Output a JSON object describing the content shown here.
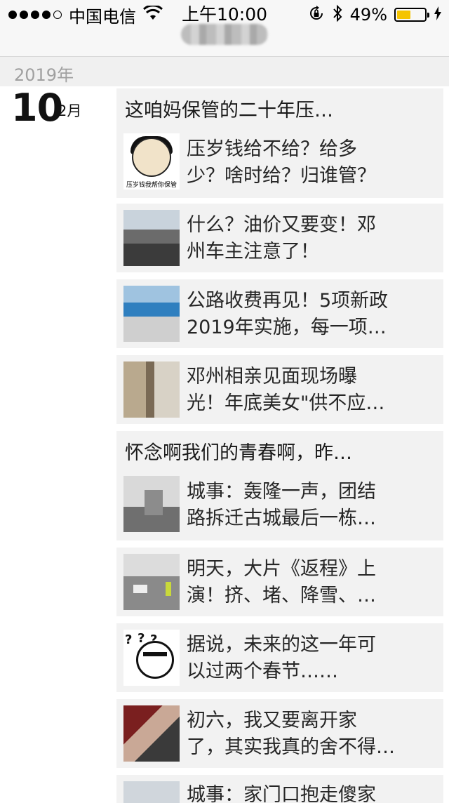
{
  "status_bar": {
    "signal_dots": 5,
    "signal_filled": 4,
    "carrier": "中国电信",
    "time": "上午10:00",
    "battery_percent": "49%",
    "battery_level": 0.49,
    "battery_color": "#f5c400"
  },
  "timeline": {
    "year": "2019年",
    "day": "10",
    "month": "2月"
  },
  "cards": [
    {
      "title": "这咱妈保管的二十年压…",
      "items": [
        {
          "thumb": "meme-panda-crying",
          "lines": [
            "压岁钱给不给？给多",
            "少？啥时给？归谁管？"
          ],
          "thumb_caption": "压岁钱我帮你保管"
        },
        {
          "thumb": "roadside-cars",
          "lines": [
            "什么？油价又要变！邓",
            "州车主注意了！"
          ]
        },
        {
          "thumb": "toll-station",
          "lines": [
            "公路收费再见！5项新政",
            "2019年实施，每一项…"
          ]
        },
        {
          "thumb": "blind-date-crowd",
          "lines": [
            "邓州相亲见面现场曝",
            "光！年底美女\"供不应…"
          ]
        }
      ]
    },
    {
      "title": "怀念啊我们的青春啊，昨…",
      "items": [
        {
          "thumb": "building-demolition",
          "lines": [
            "城事：轰隆一声，团结",
            "路拆迁古城最后一栋…"
          ]
        },
        {
          "thumb": "traffic-police",
          "lines": [
            "明天，大片《返程》上",
            "演！挤、堵、降雪、…"
          ]
        },
        {
          "thumb": "meme-question",
          "lines": [
            "据说，未来的这一年可",
            "以过两个春节……"
          ]
        },
        {
          "thumb": "phone-call",
          "lines": [
            "初六，我又要离开家",
            "了，其实我真的舍不得…"
          ]
        },
        {
          "thumb": "street",
          "lines": [
            "城事：家门口抱走傻家",
            ""
          ]
        }
      ]
    }
  ]
}
